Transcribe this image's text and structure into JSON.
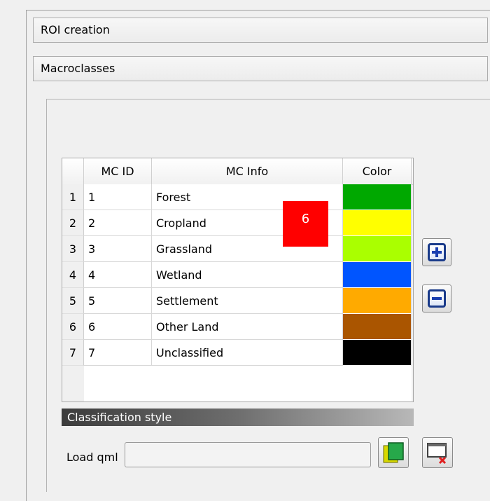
{
  "accordion": {
    "roi_creation": "ROI creation",
    "macroclasses": "Macroclasses"
  },
  "table": {
    "headers": {
      "id": "MC ID",
      "info": "MC Info",
      "color": "Color"
    },
    "rows": [
      {
        "num": "1",
        "id": "1",
        "info": "Forest",
        "color": "#00a800"
      },
      {
        "num": "2",
        "id": "2",
        "info": "Cropland",
        "color": "#ffff00"
      },
      {
        "num": "3",
        "id": "3",
        "info": "Grassland",
        "color": "#aaff00"
      },
      {
        "num": "4",
        "id": "4",
        "info": "Wetland",
        "color": "#0055ff"
      },
      {
        "num": "5",
        "id": "5",
        "info": "Settlement",
        "color": "#ffaa00"
      },
      {
        "num": "6",
        "id": "6",
        "info": "Other Land",
        "color": "#aa5500"
      },
      {
        "num": "7",
        "id": "7",
        "info": "Unclassified",
        "color": "#000000"
      }
    ]
  },
  "buttons": {
    "add_icon": "plus-icon",
    "remove_icon": "minus-icon",
    "load_icon": "load-qml-icon",
    "reset_icon": "reset-style-icon"
  },
  "style_section": {
    "title": "Classification style",
    "load_label": "Load qml",
    "load_value": ""
  },
  "overlay": {
    "label": "6",
    "color": "#ff0000"
  }
}
